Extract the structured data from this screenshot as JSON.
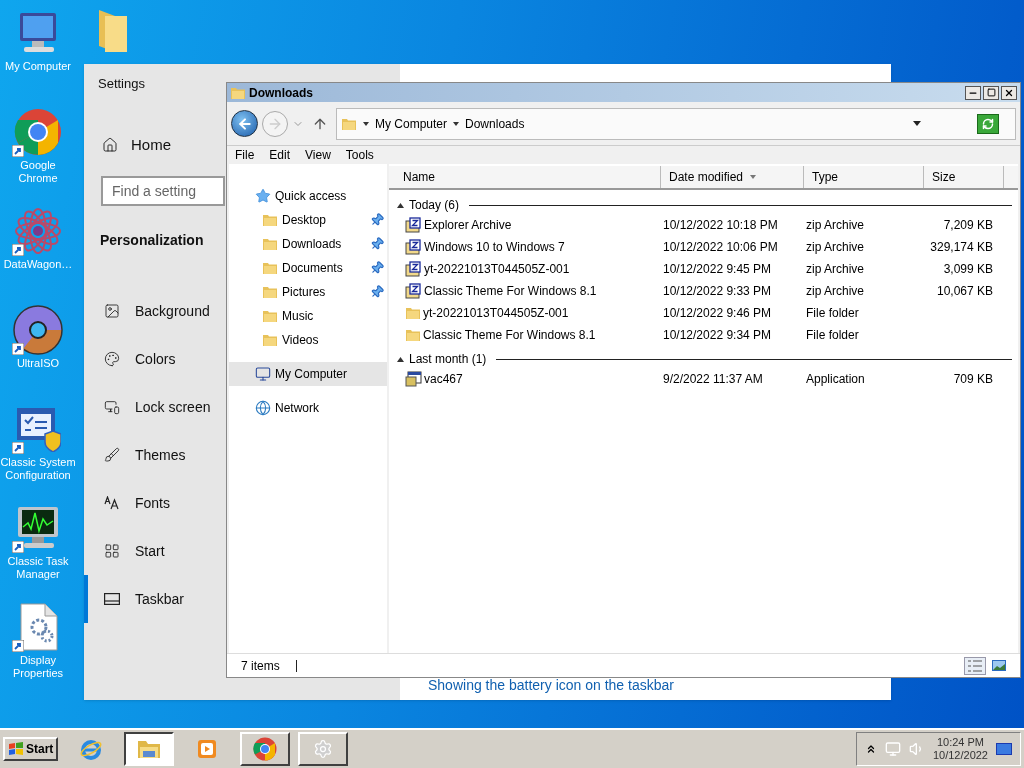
{
  "desktop_icons": [
    {
      "label": "My Computer",
      "kind": "computer",
      "shortcut": false
    },
    {
      "label": "Google Chrome",
      "kind": "chrome",
      "shortcut": true
    },
    {
      "label": "DataWagon…",
      "kind": "flower",
      "shortcut": true
    },
    {
      "label": "UltraISO",
      "kind": "disc",
      "shortcut": true
    },
    {
      "label": "Classic System Configuration",
      "kind": "config",
      "shortcut": true
    },
    {
      "label": "Classic Task Manager",
      "kind": "monitor",
      "shortcut": true
    },
    {
      "label": "Display Properties",
      "kind": "document",
      "shortcut": true
    }
  ],
  "settings": {
    "title": "Settings",
    "home": "Home",
    "search": {
      "placeholder": "Find a setting"
    },
    "section": "Personalization",
    "items": [
      {
        "label": "Background",
        "kind": "image",
        "selected": false
      },
      {
        "label": "Colors",
        "kind": "palette",
        "selected": false
      },
      {
        "label": "Lock screen",
        "kind": "lock",
        "selected": false
      },
      {
        "label": "Themes",
        "kind": "brush",
        "selected": false
      },
      {
        "label": "Fonts",
        "kind": "fonts",
        "selected": false
      },
      {
        "label": "Start",
        "kind": "start",
        "selected": false
      },
      {
        "label": "Taskbar",
        "kind": "taskbar",
        "selected": true
      }
    ],
    "link": "Showing the battery icon on the taskbar"
  },
  "explorer": {
    "title": "Downloads",
    "breadcrumb": [
      "My Computer",
      "Downloads"
    ],
    "menu": [
      "File",
      "Edit",
      "View",
      "Tools"
    ],
    "nav": [
      {
        "label": "Quick access",
        "kind": "star",
        "selected": false,
        "children": [
          {
            "label": "Desktop",
            "kind": "folder",
            "pinned": true,
            "selected": false
          },
          {
            "label": "Downloads",
            "kind": "folder",
            "pinned": true,
            "selected": false
          },
          {
            "label": "Documents",
            "kind": "folder",
            "pinned": true,
            "selected": false
          },
          {
            "label": "Pictures",
            "kind": "folder",
            "pinned": true,
            "selected": false
          },
          {
            "label": "Music",
            "kind": "folder",
            "pinned": false,
            "selected": false
          },
          {
            "label": "Videos",
            "kind": "folder",
            "pinned": false,
            "selected": false
          }
        ]
      },
      {
        "label": "My Computer",
        "kind": "computer",
        "selected": true
      },
      {
        "label": "Network",
        "kind": "network",
        "selected": false
      }
    ],
    "columns": [
      {
        "label": "Name",
        "sorted": false
      },
      {
        "label": "Date modified",
        "sorted": true
      },
      {
        "label": "Type",
        "sorted": false
      },
      {
        "label": "Size",
        "sorted": false
      }
    ],
    "groups": [
      {
        "label": "Today (6)",
        "expanded": true,
        "rows": [
          {
            "name": "Explorer Archive",
            "date": "10/12/2022 10:18 PM",
            "type": "zip Archive",
            "size": "7,209 KB",
            "kind": "zip"
          },
          {
            "name": "Windows 10 to Windows 7",
            "date": "10/12/2022 10:06 PM",
            "type": "zip Archive",
            "size": "329,174 KB",
            "kind": "zip"
          },
          {
            "name": "yt-20221013T044505Z-001",
            "date": "10/12/2022 9:45 PM",
            "type": "zip Archive",
            "size": "3,099 KB",
            "kind": "zip"
          },
          {
            "name": "Classic Theme For Windows 8.1",
            "date": "10/12/2022 9:33 PM",
            "type": "zip Archive",
            "size": "10,067 KB",
            "kind": "zip"
          },
          {
            "name": "yt-20221013T044505Z-001",
            "date": "10/12/2022 9:46 PM",
            "type": "File folder",
            "kind": "folder"
          },
          {
            "name": "Classic Theme For Windows 8.1",
            "date": "10/12/2022 9:34 PM",
            "type": "File folder",
            "kind": "folder"
          }
        ]
      },
      {
        "label": "Last month (1)",
        "expanded": true,
        "rows": [
          {
            "name": "vac467",
            "date": "9/2/2022 11:37 AM",
            "type": "Application",
            "size": "709 KB",
            "kind": "app"
          }
        ]
      }
    ],
    "status": "7 items"
  },
  "taskbar": {
    "start": "Start",
    "buttons": [
      {
        "kind": "ie",
        "running": false,
        "active": false
      },
      {
        "kind": "explorer",
        "running": true,
        "active": true
      },
      {
        "kind": "media",
        "running": false,
        "active": false
      },
      {
        "kind": "chrome",
        "running": true,
        "active": false
      },
      {
        "kind": "settings",
        "running": true,
        "active": false
      }
    ],
    "time": "10:24 PM",
    "date": "10/12/2022"
  }
}
